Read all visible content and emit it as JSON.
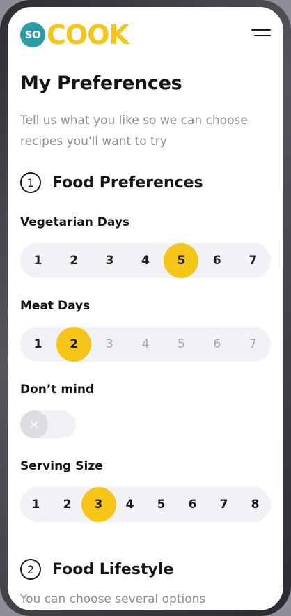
{
  "logo": {
    "badge": "SO",
    "word": "COOK"
  },
  "page": {
    "title": "My Preferences",
    "subtitle": "Tell us what you like so we can choose recipes you'll want to try"
  },
  "sections": [
    {
      "number": "1",
      "title": "Food Preferences"
    },
    {
      "number": "2",
      "title": "Food Lifestyle",
      "hint": "You can choose several options"
    }
  ],
  "vegetarian_days": {
    "label": "Vegetarian Days",
    "options": [
      "1",
      "2",
      "3",
      "4",
      "5",
      "6",
      "7"
    ],
    "selected": "5"
  },
  "meat_days": {
    "label": "Meat Days",
    "options": [
      "1",
      "2",
      "3",
      "4",
      "5",
      "6",
      "7"
    ],
    "selected": "2",
    "enabled_max": "2"
  },
  "dont_mind": {
    "label": "Don’t mind",
    "state": "off",
    "knob_icon": "×"
  },
  "serving_size": {
    "label": "Serving Size",
    "options": [
      "1",
      "2",
      "3",
      "4",
      "5",
      "6",
      "7",
      "8"
    ],
    "selected": "3"
  },
  "colors": {
    "accent": "#f5c518",
    "brand_badge": "#2b9ba6",
    "muted_text": "#8d8d8d",
    "track": "#f1f2f5"
  }
}
